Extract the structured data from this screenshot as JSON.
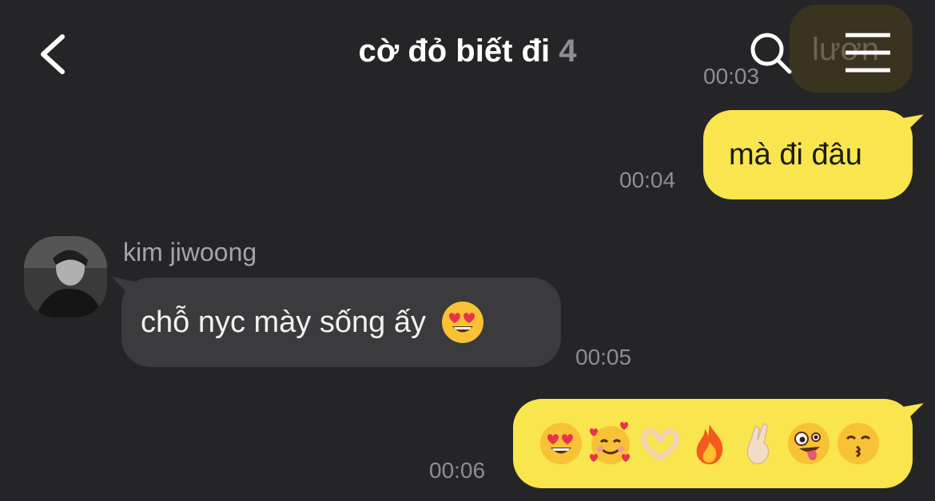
{
  "header": {
    "title": "cờ đỏ biết đi",
    "member_count": "4",
    "back_icon": "chevron-left-icon",
    "search_icon": "search-icon",
    "menu_icon": "hamburger-menu-icon"
  },
  "previous_message": {
    "text": "lươn",
    "time": "00:03"
  },
  "messages": [
    {
      "sender": "me",
      "text": "mà đi đâu",
      "time": "00:04"
    },
    {
      "sender": "kim jiwoong",
      "text": "chỗ nyc mày sống ấy",
      "emoji": "heart-eyes-emoji",
      "time": "00:05"
    },
    {
      "sender": "me",
      "emojis": [
        "heart-eyes-emoji",
        "smiling-face-with-hearts-emoji",
        "heart-hands-emoji",
        "fire-emoji",
        "crossed-fingers-emoji",
        "zany-face-emoji",
        "kissing-face-emoji"
      ],
      "time": "00:06"
    }
  ],
  "colors": {
    "background": "#252527",
    "my_bubble": "#f9e54d",
    "their_bubble": "#3b3b3e"
  }
}
